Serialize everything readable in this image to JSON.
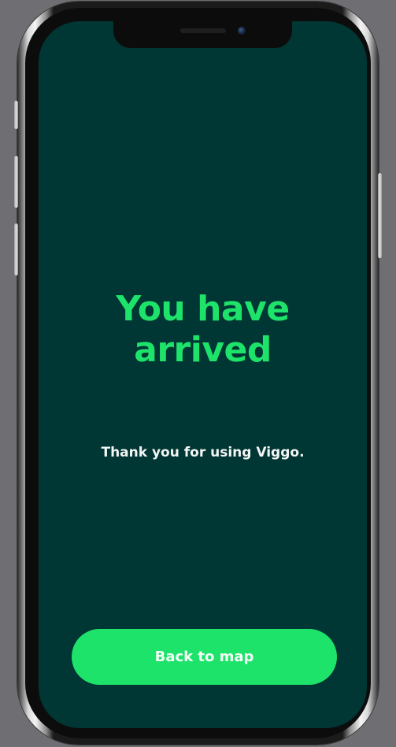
{
  "screen": {
    "headline_line1": "You have",
    "headline_line2": "arrived",
    "subtitle": "Thank you for using Viggo.",
    "button_label": "Back to map"
  },
  "colors": {
    "background": "#003633",
    "accent": "#1ee36a",
    "text": "#f2f5f4"
  }
}
